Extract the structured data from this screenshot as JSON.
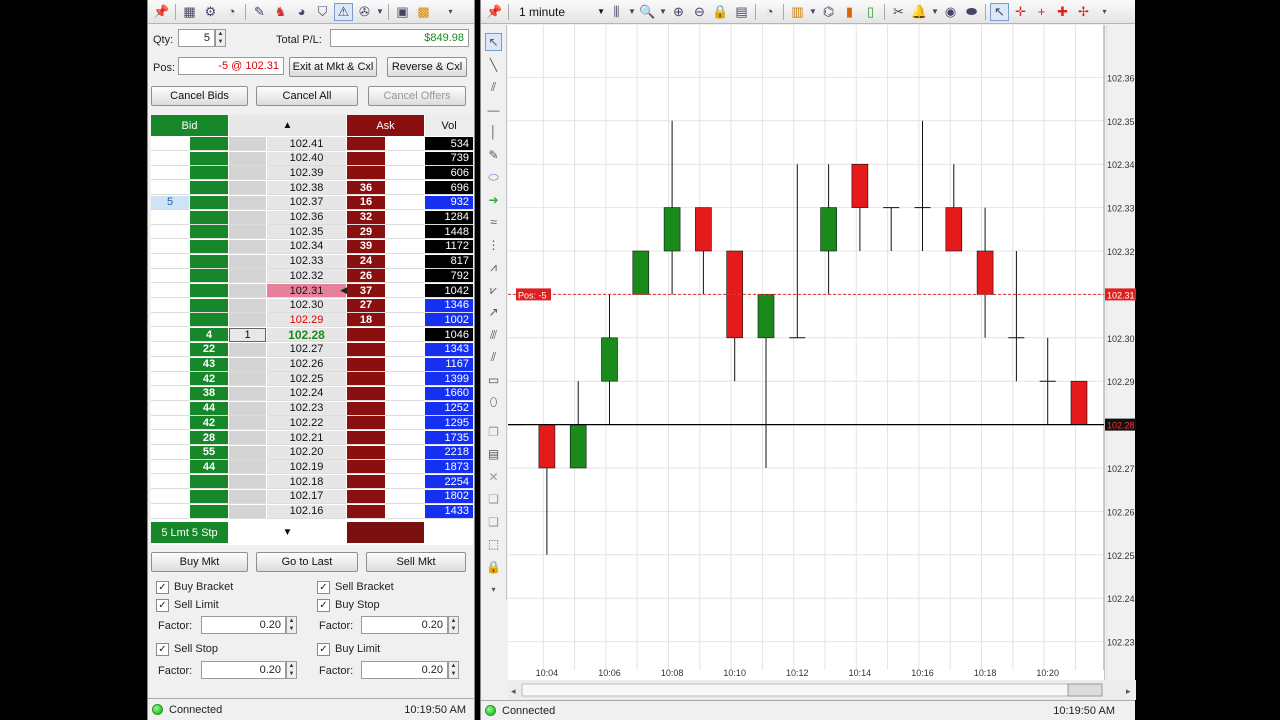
{
  "dom": {
    "qty_label": "Qty:",
    "qty_value": "5",
    "total_pl_label": "Total P/L:",
    "total_pl_value": "$849.98",
    "pos_label": "Pos:",
    "pos_value": "-5 @ 102.31",
    "exit_label": "Exit at Mkt & Cxl",
    "reverse_label": "Reverse & Cxl",
    "cancel_bids": "Cancel Bids",
    "cancel_all": "Cancel All",
    "cancel_offers": "Cancel Offers",
    "bid_header": "Bid",
    "ask_header": "Ask",
    "vol_header": "Vol",
    "bracket_label": "5 Lmt 5 Stp",
    "buy_mkt": "Buy Mkt",
    "go_to_last": "Go to Last",
    "sell_mkt": "Sell Mkt",
    "buy_bracket": "Buy Bracket",
    "sell_bracket": "Sell Bracket",
    "sell_limit": "Sell Limit",
    "buy_stop": "Buy Stop",
    "sell_stop": "Sell Stop",
    "buy_limit": "Buy Limit",
    "factor_label": "Factor:",
    "factor_1": "0.20",
    "factor_2": "0.20",
    "factor_3": "0.20",
    "factor_4": "0.20",
    "status": "Connected",
    "time": "10:19:50 AM",
    "rows": [
      {
        "price": "102.41",
        "bid": "",
        "ask": "",
        "vol": "534"
      },
      {
        "price": "102.40",
        "bid": "",
        "ask": "",
        "vol": "739"
      },
      {
        "price": "102.39",
        "bid": "",
        "ask": "",
        "vol": "606"
      },
      {
        "price": "102.38",
        "bid": "",
        "ask": "36",
        "vol": "696"
      },
      {
        "price": "102.37",
        "bid": "",
        "ask": "16",
        "vol": "932",
        "myorder": "5"
      },
      {
        "price": "102.36",
        "bid": "",
        "ask": "32",
        "vol": "1284"
      },
      {
        "price": "102.35",
        "bid": "",
        "ask": "29",
        "vol": "1448"
      },
      {
        "price": "102.34",
        "bid": "",
        "ask": "39",
        "vol": "1172"
      },
      {
        "price": "102.33",
        "bid": "",
        "ask": "24",
        "vol": "817"
      },
      {
        "price": "102.32",
        "bid": "",
        "ask": "26",
        "vol": "792"
      },
      {
        "price": "102.31",
        "bid": "",
        "ask": "37",
        "vol": "1042",
        "pos": true
      },
      {
        "price": "102.30",
        "bid": "",
        "ask": "27",
        "vol": "1346"
      },
      {
        "price": "102.29",
        "bid": "",
        "ask": "18",
        "vol": "1002",
        "red": true
      },
      {
        "price": "102.28",
        "bid": "4",
        "ask": "",
        "vol": "1046",
        "last": true,
        "lastqty": "1"
      },
      {
        "price": "102.27",
        "bid": "22",
        "ask": "",
        "vol": "1343"
      },
      {
        "price": "102.26",
        "bid": "43",
        "ask": "",
        "vol": "1167"
      },
      {
        "price": "102.25",
        "bid": "42",
        "ask": "",
        "vol": "1399"
      },
      {
        "price": "102.24",
        "bid": "38",
        "ask": "",
        "vol": "1660"
      },
      {
        "price": "102.23",
        "bid": "44",
        "ask": "",
        "vol": "1252"
      },
      {
        "price": "102.22",
        "bid": "42",
        "ask": "",
        "vol": "1295"
      },
      {
        "price": "102.21",
        "bid": "28",
        "ask": "",
        "vol": "1735"
      },
      {
        "price": "102.20",
        "bid": "55",
        "ask": "",
        "vol": "2218"
      },
      {
        "price": "102.19",
        "bid": "44",
        "ask": "",
        "vol": "1873"
      },
      {
        "price": "102.18",
        "bid": "",
        "ask": "",
        "vol": "2254"
      },
      {
        "price": "102.17",
        "bid": "",
        "ask": "",
        "vol": "1802"
      },
      {
        "price": "102.16",
        "bid": "",
        "ask": "",
        "vol": "1433"
      }
    ]
  },
  "chart": {
    "interval": "1 minute",
    "status": "Connected",
    "time": "10:19:50 AM",
    "pos_marker": "Pos: -5",
    "pos_price": "102.31",
    "last_price": "102.28",
    "colors": {
      "up": "#1a8a1a",
      "down": "#e51b1b",
      "pos_line": "#e53030"
    }
  },
  "chart_data": {
    "type": "candlestick",
    "x_ticks": [
      "10:04",
      "10:06",
      "10:08",
      "10:10",
      "10:12",
      "10:14",
      "10:16",
      "10:18",
      "10:20"
    ],
    "y_ticks": [
      "102.36",
      "102.35",
      "102.34",
      "102.33",
      "102.32",
      "102.31",
      "102.30",
      "102.29",
      "102.28",
      "102.27",
      "102.26",
      "102.25",
      "102.24",
      "102.23"
    ],
    "ylim": [
      102.227,
      102.371
    ],
    "candles": [
      {
        "t": "10:03",
        "o": 102.28,
        "h": 102.28,
        "l": 102.28,
        "c": 102.28
      },
      {
        "t": "10:04",
        "o": 102.28,
        "h": 102.28,
        "l": 102.25,
        "c": 102.27
      },
      {
        "t": "10:05",
        "o": 102.27,
        "h": 102.29,
        "l": 102.27,
        "c": 102.28
      },
      {
        "t": "10:06",
        "o": 102.29,
        "h": 102.31,
        "l": 102.28,
        "c": 102.3
      },
      {
        "t": "10:07",
        "o": 102.31,
        "h": 102.32,
        "l": 102.31,
        "c": 102.32
      },
      {
        "t": "10:08",
        "o": 102.32,
        "h": 102.35,
        "l": 102.31,
        "c": 102.33
      },
      {
        "t": "10:09",
        "o": 102.33,
        "h": 102.33,
        "l": 102.31,
        "c": 102.32
      },
      {
        "t": "10:10",
        "o": 102.32,
        "h": 102.32,
        "l": 102.29,
        "c": 102.3
      },
      {
        "t": "10:11",
        "o": 102.3,
        "h": 102.31,
        "l": 102.27,
        "c": 102.31
      },
      {
        "t": "10:12",
        "o": 102.3,
        "h": 102.34,
        "l": 102.3,
        "c": 102.3
      },
      {
        "t": "10:13",
        "o": 102.32,
        "h": 102.34,
        "l": 102.31,
        "c": 102.33
      },
      {
        "t": "10:14",
        "o": 102.34,
        "h": 102.34,
        "l": 102.32,
        "c": 102.33
      },
      {
        "t": "10:15",
        "o": 102.33,
        "h": 102.33,
        "l": 102.32,
        "c": 102.33
      },
      {
        "t": "10:16",
        "o": 102.33,
        "h": 102.35,
        "l": 102.32,
        "c": 102.33
      },
      {
        "t": "10:17",
        "o": 102.33,
        "h": 102.34,
        "l": 102.32,
        "c": 102.32
      },
      {
        "t": "10:18",
        "o": 102.32,
        "h": 102.33,
        "l": 102.3,
        "c": 102.31
      },
      {
        "t": "10:19",
        "o": 102.3,
        "h": 102.32,
        "l": 102.29,
        "c": 102.3
      },
      {
        "t": "10:20",
        "o": 102.29,
        "h": 102.3,
        "l": 102.28,
        "c": 102.29
      },
      {
        "t": "10:21",
        "o": 102.29,
        "h": 102.29,
        "l": 102.28,
        "c": 102.28
      }
    ]
  }
}
